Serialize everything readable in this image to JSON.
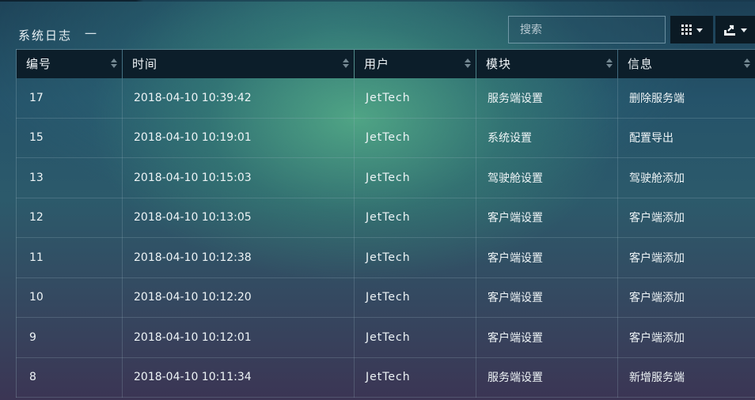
{
  "panel": {
    "title": "系统日志",
    "collapse_symbol": "一"
  },
  "search": {
    "placeholder": "搜索"
  },
  "toolbar": {
    "columns_icon": "grid-icon",
    "export_icon": "export-icon"
  },
  "table": {
    "columns": [
      "编号",
      "时间",
      "用户",
      "模块",
      "信息"
    ],
    "rows": [
      [
        "17",
        "2018-04-10 10:39:42",
        "JetTech",
        "服务端设置",
        "删除服务端"
      ],
      [
        "15",
        "2018-04-10 10:19:01",
        "JetTech",
        "系统设置",
        "配置导出"
      ],
      [
        "13",
        "2018-04-10 10:15:03",
        "JetTech",
        "驾驶舱设置",
        "驾驶舱添加"
      ],
      [
        "12",
        "2018-04-10 10:13:05",
        "JetTech",
        "客户端设置",
        "客户端添加"
      ],
      [
        "11",
        "2018-04-10 10:12:38",
        "JetTech",
        "客户端设置",
        "客户端添加"
      ],
      [
        "10",
        "2018-04-10 10:12:20",
        "JetTech",
        "客户端设置",
        "客户端添加"
      ],
      [
        "9",
        "2018-04-10 10:12:01",
        "JetTech",
        "客户端设置",
        "客户端添加"
      ],
      [
        "8",
        "2018-04-10 10:11:34",
        "JetTech",
        "服务端设置",
        "新增服务端"
      ]
    ]
  }
}
